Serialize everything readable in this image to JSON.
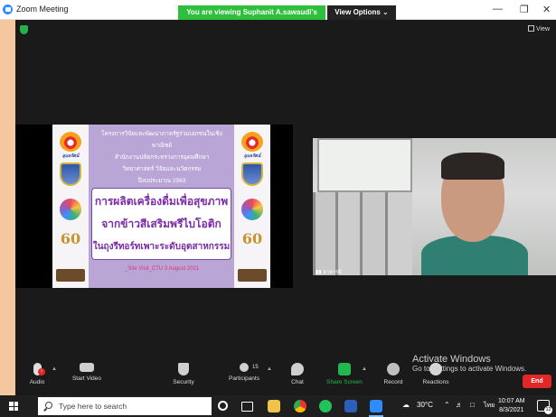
{
  "titlebar": {
    "app_title": "Zoom Meeting",
    "share_banner": "You are viewing Suphanit A.sawaudi's screen",
    "view_options": "View Options ⌄",
    "minimize": "—",
    "maximize": "❐",
    "close": "✕"
  },
  "main": {
    "view_label": "View"
  },
  "slide": {
    "header_lines": [
      "โครงการวิจัยและพัฒนาภาครัฐร่วมเอกชนในเชิงพาณิชย์",
      "สำนักงานปลัดกระทรวงการอุดมศึกษา",
      "วิทยาศาสตร์ วิจัยและนวัตกรรม",
      "ปีงบประมาณ 2563"
    ],
    "title_lines": [
      "การผลิตเครื่องดื่มเพื่อสุขภาพ",
      "จากข้าวสีเสริมพรีไบโอติก",
      "ในถุงรีทอร์ทเพาะระดับอุตสาหกรรม"
    ],
    "footer": "_Site Visit_CTU 3 August 2021",
    "logo_label": "อุบลรัตน์"
  },
  "video": {
    "participant_name": "อาจารย์"
  },
  "toolbar": {
    "audio": "Audio",
    "start_video": "Start Video",
    "security": "Security",
    "participants": "Participants",
    "participants_count": "15",
    "chat": "Chat",
    "share_screen": "Share Screen",
    "record": "Record",
    "reactions": "Reactions",
    "end": "End"
  },
  "watermark": {
    "title": "Activate Windows",
    "subtitle": "Go to Settings to activate Windows."
  },
  "taskbar": {
    "search_placeholder": "Type here to search",
    "weather": "30°C",
    "language": "ไทย",
    "time": "10:07 AM",
    "date": "8/3/2021",
    "notifications_count": "12"
  },
  "colors": {
    "share_banner": "#2ebf3c",
    "end_button": "#e02828",
    "share_icon": "#21b850",
    "slide_purple": "#b9a6d6"
  }
}
